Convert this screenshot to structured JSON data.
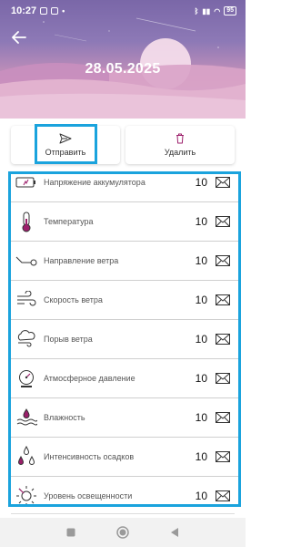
{
  "status_bar": {
    "time": "10:27",
    "battery": "95"
  },
  "header": {
    "date": "28.05.2025"
  },
  "actions": {
    "send_label": "Отправить",
    "delete_label": "Удалить"
  },
  "rows": [
    {
      "label": "Напряжение аккумулятора",
      "count": "10",
      "icon": "battery-voltage-icon"
    },
    {
      "label": "Температура",
      "count": "10",
      "icon": "thermometer-icon"
    },
    {
      "label": "Направление ветра",
      "count": "10",
      "icon": "wind-direction-icon"
    },
    {
      "label": "Скорость ветра",
      "count": "10",
      "icon": "wind-speed-icon"
    },
    {
      "label": "Порыв ветра",
      "count": "10",
      "icon": "wind-gust-icon"
    },
    {
      "label": "Атмосферное давление",
      "count": "10",
      "icon": "barometer-icon"
    },
    {
      "label": "Влажность",
      "count": "10",
      "icon": "humidity-icon"
    },
    {
      "label": "Интенсивность осадков",
      "count": "10",
      "icon": "precipitation-icon"
    },
    {
      "label": "Уровень освещенности",
      "count": "10",
      "icon": "sun-icon"
    }
  ],
  "colors": {
    "accent": "#1aa3dd",
    "icon_accent": "#9c1f6b"
  }
}
